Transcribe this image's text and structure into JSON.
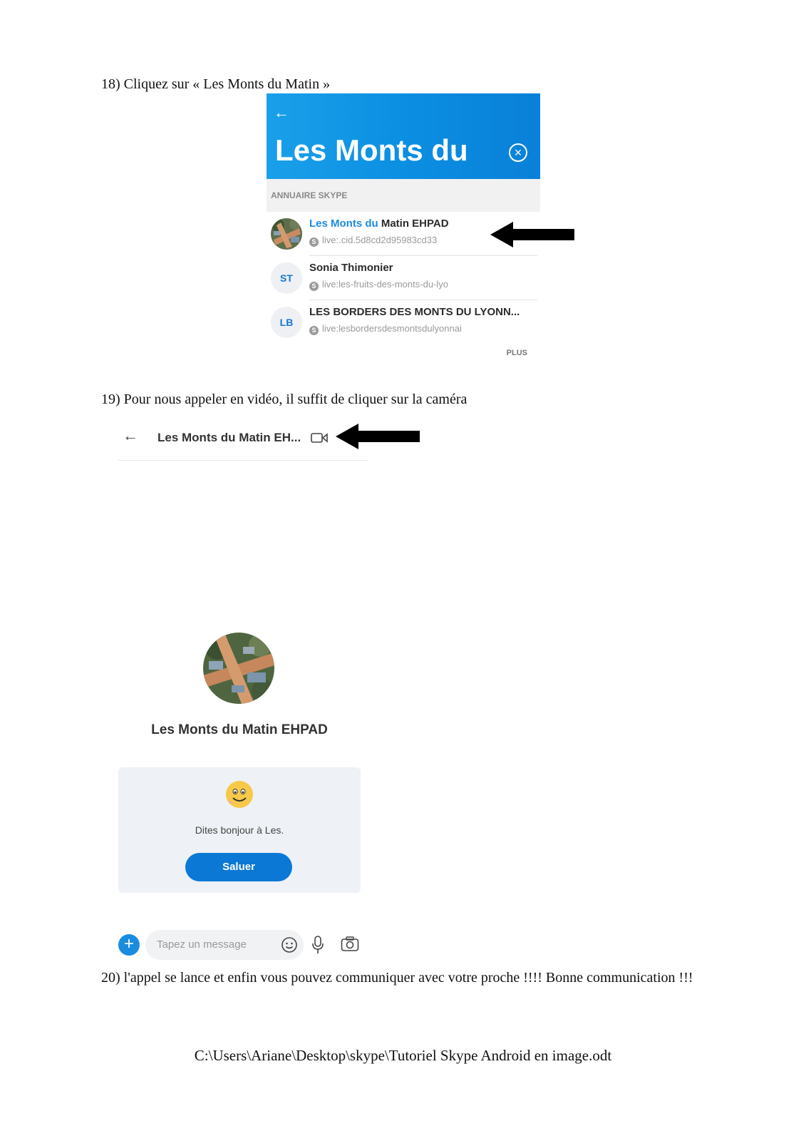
{
  "steps": {
    "s18": "18) Cliquez sur « Les Monts du Matin »",
    "s19": "19) Pour nous appeler en vidéo, il suffit de cliquer sur la caméra",
    "s20": "20) l'appel se lance et enfin vous pouvez communiquer avec votre proche !!!! Bonne communication !!!"
  },
  "search": {
    "query": "Les Monts du",
    "section": "ANNUAIRE SKYPE",
    "results": [
      {
        "initials": "",
        "name_highlight": "Les Monts du",
        "name_rest": " Matin EHPAD",
        "id": "live:.cid.5d8cd2d95983cd33"
      },
      {
        "initials": "ST",
        "name_highlight": "",
        "name_rest": "Sonia Thimonier",
        "id": "live:les-fruits-des-monts-du-lyo"
      },
      {
        "initials": "LB",
        "name_highlight": "",
        "name_rest": "LES BORDERS DES MONTS DU LYONN...",
        "id": "live:lesbordersdesmontsdulyonnai"
      }
    ],
    "more": "PLUS"
  },
  "chat_header": {
    "title": "Les Monts du Matin EH..."
  },
  "conversation": {
    "contact_name": "Les Monts du Matin EHPAD",
    "greeting": "Dites bonjour à Les.",
    "greet_button": "Saluer",
    "input_placeholder": "Tapez un message"
  },
  "footer": "C:\\Users\\Ariane\\Desktop\\skype\\Tutoriel Skype Android en image.odt",
  "colors": {
    "accent": "#0b8fe2",
    "button": "#0b78d6"
  }
}
